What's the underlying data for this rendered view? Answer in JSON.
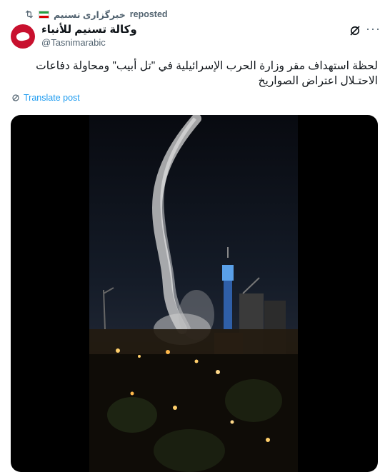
{
  "repost": {
    "account": "خبرگزاری تسنیم",
    "label": "reposted",
    "icon": "repost-icon"
  },
  "author": {
    "name": "وكالة تسنيم للأنباء",
    "handle": "@Tasnimarabic",
    "avatar_color": "#c8102e"
  },
  "post": {
    "text": "لحظة استهداف مقر وزارة الحرب الإسرائيلية في \"تل أبيب\" ومحاولة دفاعات الاحتـلال اعتراض الصواريخ",
    "translate_label": "Translate post"
  },
  "actions": {
    "grok_icon": "grok-icon",
    "more": "···"
  },
  "colors": {
    "link": "#1d9bf0",
    "secondary": "#536471"
  }
}
